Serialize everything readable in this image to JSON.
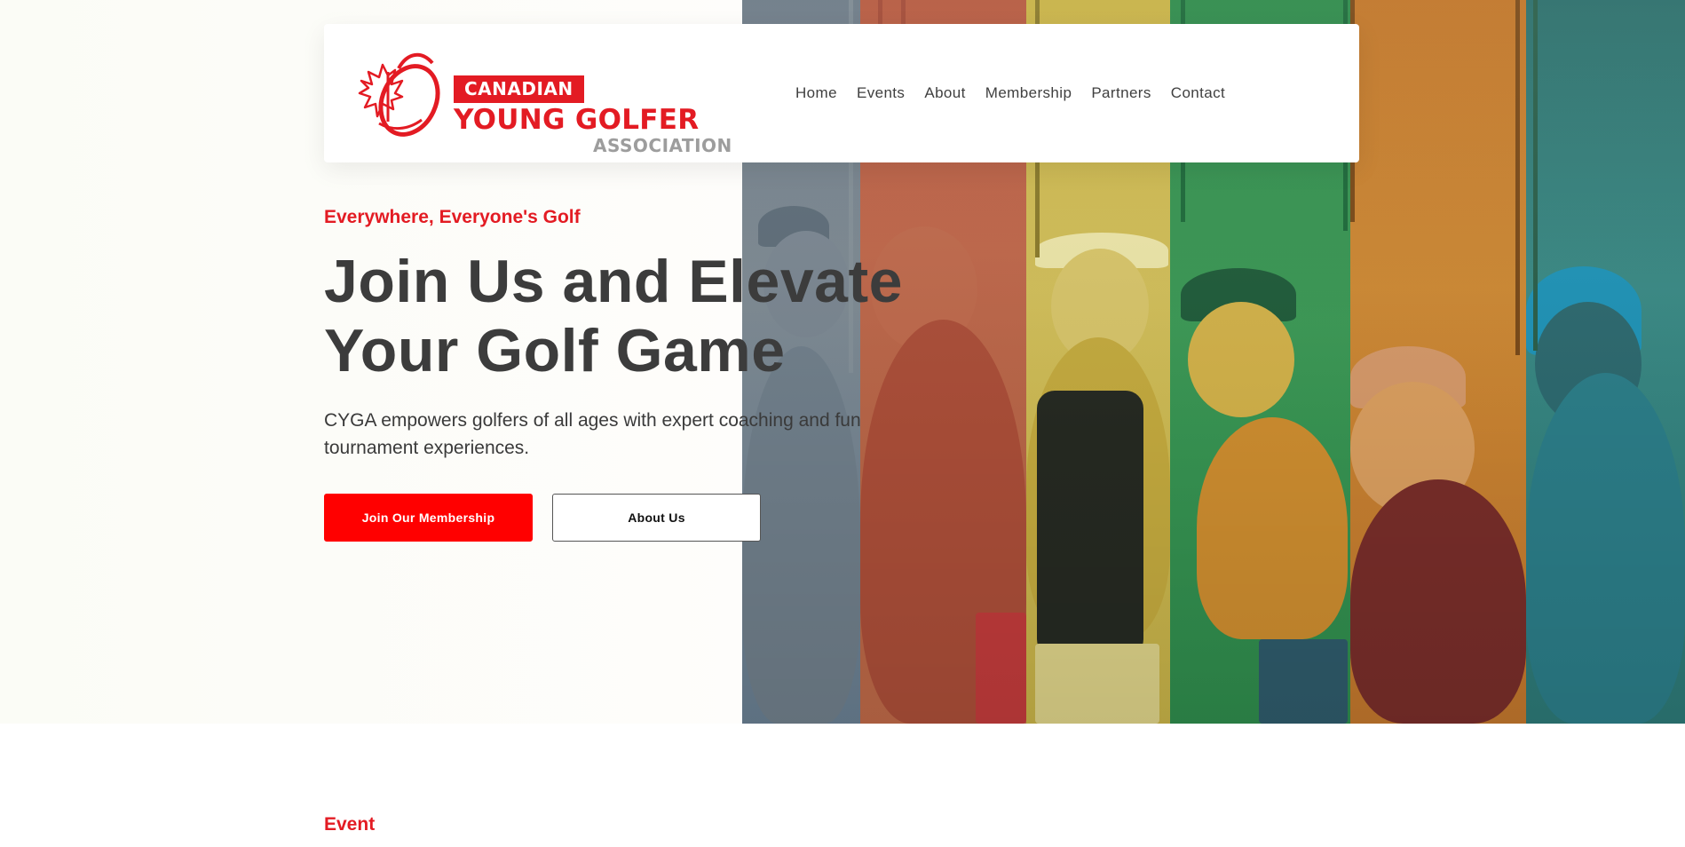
{
  "brand": {
    "banner": "CANADIAN",
    "name_line1": "YOUNG GOLFER",
    "name_line2": "ASSOCIATION",
    "primary_color": "#e31b23",
    "secondary_color": "#9d9d9d"
  },
  "nav": {
    "items": [
      {
        "label": "Home"
      },
      {
        "label": "Events"
      },
      {
        "label": "About"
      },
      {
        "label": "Membership"
      },
      {
        "label": "Partners"
      },
      {
        "label": "Contact"
      }
    ]
  },
  "hero": {
    "eyebrow": "Everywhere, Everyone's Golf",
    "headline_line1": "Join Us and Elevate",
    "headline_line2": "Your Golf Game",
    "description_line1": "CYGA empowers golfers of all ages with expert coaching and fun",
    "description_line2": "tournament experiences.",
    "primary_cta": "Join Our Membership",
    "secondary_cta": "About Us",
    "cta_color": "#ff0000",
    "photo_tints": [
      "#6c7a86",
      "#c0674a",
      "#d3c05a",
      "#3c9a56",
      "#cf8a34",
      "#3a8b86"
    ]
  },
  "section": {
    "event_label": "Event"
  }
}
